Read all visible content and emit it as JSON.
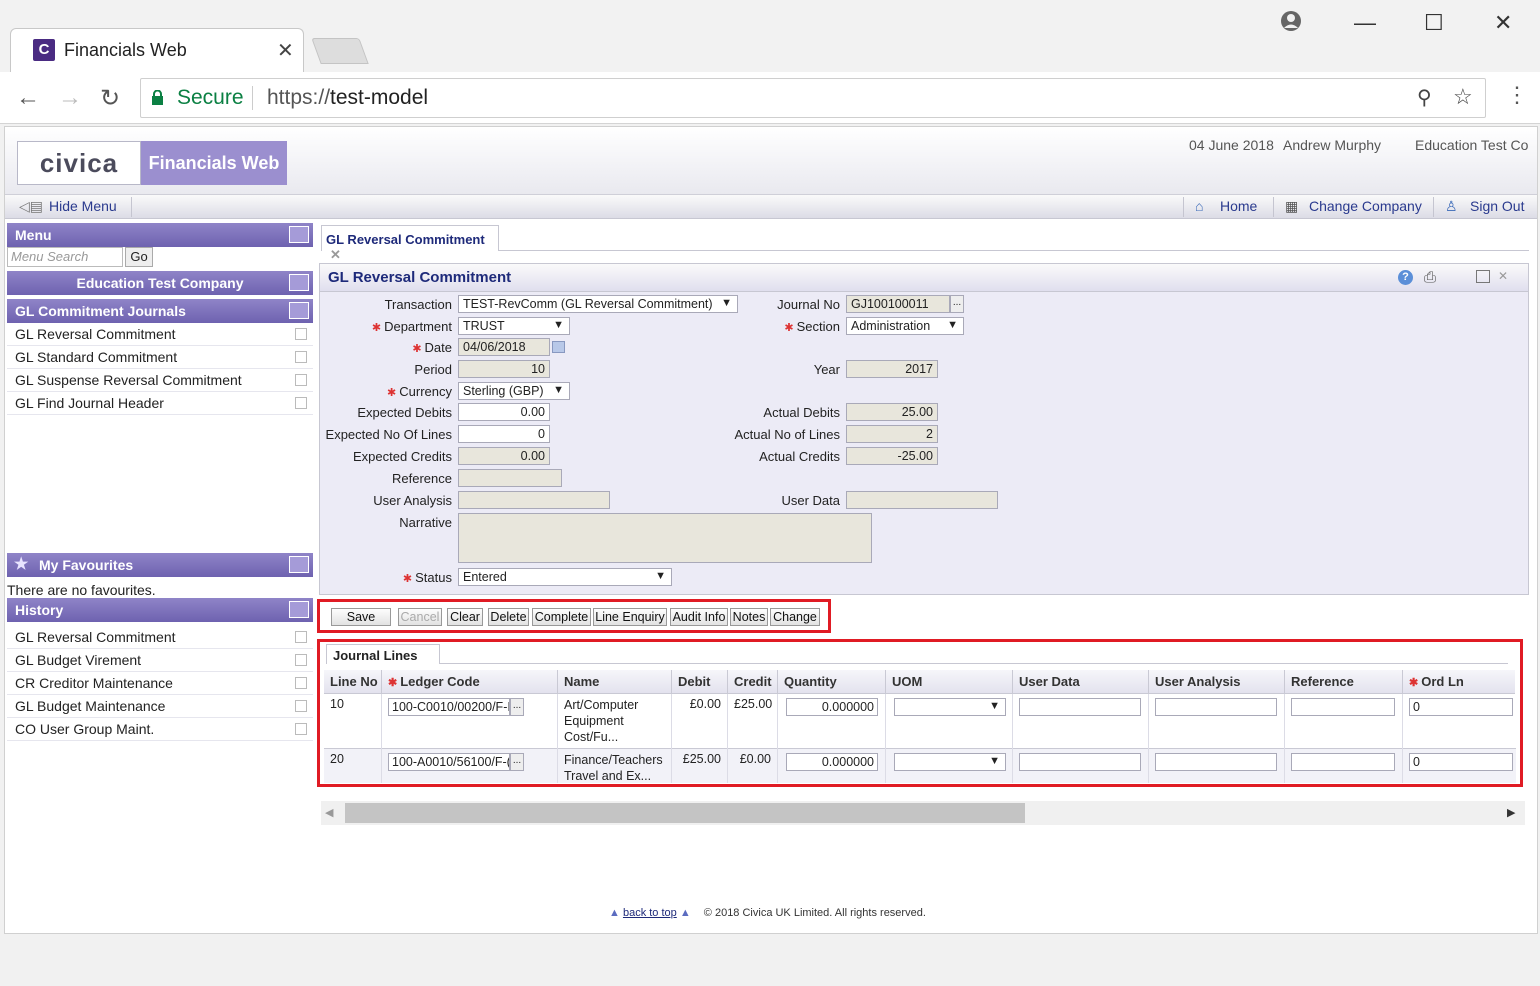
{
  "browser": {
    "tab_title": "Financials Web",
    "favicon_letter": "C",
    "secure_label": "Secure",
    "url_scheme": "https://",
    "url_host": "test-model"
  },
  "app": {
    "logo_text": "civica",
    "product_name": "Financials Web",
    "date": "04 June 2018",
    "user": "Andrew Murphy",
    "company": "Education Test Co",
    "hide_menu": "Hide Menu",
    "home": "Home",
    "change_company": "Change Company",
    "sign_out": "Sign Out"
  },
  "menu": {
    "title": "Menu",
    "search_placeholder": "Menu Search",
    "go": "Go",
    "company_title": "Education Test Company",
    "group_title": "GL Commitment Journals",
    "items": [
      "GL Reversal Commitment",
      "GL Standard Commitment",
      "GL Suspense Reversal Commitment",
      "GL Find Journal Header"
    ]
  },
  "favourites": {
    "title": "My Favourites",
    "empty_text": "There are no favourites."
  },
  "history": {
    "title": "History",
    "items": [
      "GL Reversal Commitment",
      "GL Budget Virement",
      "CR Creditor Maintenance",
      "GL Budget Maintenance",
      "CO User Group Maint."
    ]
  },
  "content": {
    "tab_label": "GL Reversal Commitment",
    "form_title": "GL Reversal Commitment",
    "fields": {
      "transaction_label": "Transaction",
      "transaction_value": "TEST-RevComm (GL Reversal Commitment)",
      "journal_no_label": "Journal No",
      "journal_no_value": "GJ100100011",
      "department_label": "Department",
      "department_value": "TRUST",
      "section_label": "Section",
      "section_value": "Administration",
      "date_label": "Date",
      "date_value": "04/06/2018",
      "period_label": "Period",
      "period_value": "10",
      "year_label": "Year",
      "year_value": "2017",
      "currency_label": "Currency",
      "currency_value": "Sterling (GBP)",
      "exp_debits_label": "Expected Debits",
      "exp_debits_value": "0.00",
      "act_debits_label": "Actual Debits",
      "act_debits_value": "25.00",
      "exp_lines_label": "Expected No Of Lines",
      "exp_lines_value": "0",
      "act_lines_label": "Actual No of Lines",
      "act_lines_value": "2",
      "exp_credits_label": "Expected Credits",
      "exp_credits_value": "0.00",
      "act_credits_label": "Actual Credits",
      "act_credits_value": "-25.00",
      "reference_label": "Reference",
      "reference_value": "",
      "user_analysis_label": "User Analysis",
      "user_analysis_value": "",
      "user_data_label": "User Data",
      "user_data_value": "",
      "narrative_label": "Narrative",
      "narrative_value": "",
      "status_label": "Status",
      "status_value": "Entered"
    },
    "buttons": [
      "Save",
      "Cancel",
      "Clear",
      "Delete",
      "Complete",
      "Line Enquiry",
      "Audit Info",
      "Notes",
      "Change"
    ]
  },
  "journal_lines": {
    "tab_label": "Journal Lines",
    "columns": [
      "Line No",
      "Ledger Code",
      "Name",
      "Debit",
      "Credit",
      "Quantity",
      "UOM",
      "User Data",
      "User Analysis",
      "Reference",
      "Ord Ln"
    ],
    "rows": [
      {
        "line_no": "10",
        "ledger_code": "100-C0010/00200/F-I",
        "name_1": "Art/Computer",
        "name_2": "Equipment",
        "name_3": "Cost/Fu...",
        "debit": "£0.00",
        "credit": "£25.00",
        "quantity": "0.000000",
        "ord_ln": "0"
      },
      {
        "line_no": "20",
        "ledger_code": "100-A0010/56100/F-(",
        "name_1": "Finance/Teachers",
        "name_2": "Travel and Ex...",
        "name_3": "",
        "debit": "£25.00",
        "credit": "£0.00",
        "quantity": "0.000000",
        "ord_ln": "0"
      }
    ]
  },
  "footer": {
    "back_to_top": "back to top",
    "copyright": "© 2018 Civica UK Limited. All rights reserved."
  },
  "colors": {
    "accent": "#7d72bf",
    "highlight": "#e01b24",
    "link": "#1e2a7a"
  }
}
